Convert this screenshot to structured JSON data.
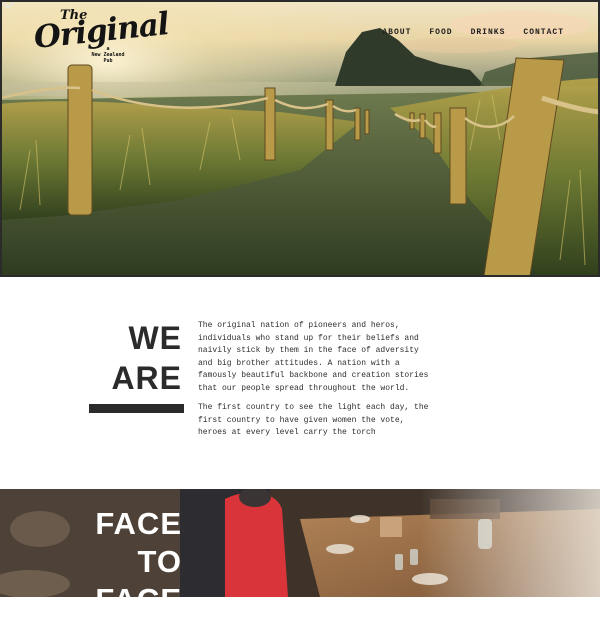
{
  "logo": {
    "the": "The",
    "main": "Original",
    "tagline_line1": "a",
    "tagline_line2": "New Zealand",
    "tagline_line3": "Pub"
  },
  "nav": {
    "items": [
      "ABOUT",
      "FOOD",
      "DRINKS",
      "CONTACT"
    ]
  },
  "about": {
    "heading_line1": "WE",
    "heading_line2": "ARE",
    "paragraph1": "The original nation of pioneers and heros, individuals who stand up for their beliefs and naivily stick by them in the face of adversity and big brother attitudes. A nation with a famously beautiful backbone and creation stories that our people spread throughout the world.",
    "paragraph2": "The first country to see the light each day, the first country to have given women the vote, heroes at every level carry the torch"
  },
  "bottom": {
    "heading_line1": "FACE",
    "heading_line2": "TO",
    "heading_line3": "FACE"
  },
  "colors": {
    "heading": "#2b2b2b",
    "body_text": "#2e2e2e",
    "nav_text": "#1e1e1e"
  },
  "icons": {
    "scroll_down": "chevron-down-icon"
  }
}
